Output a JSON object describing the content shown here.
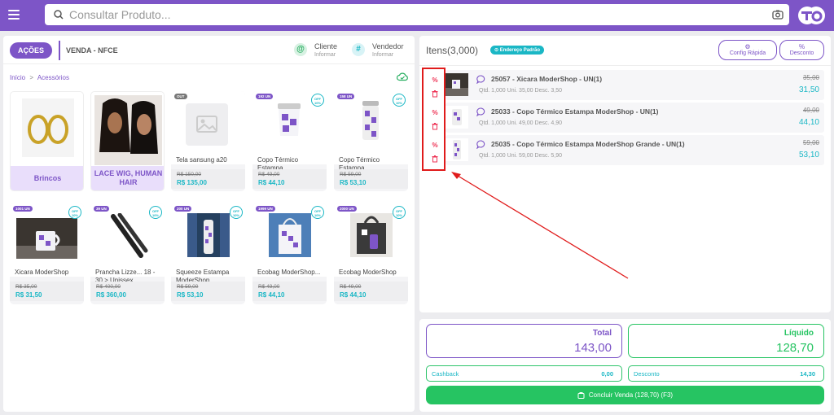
{
  "search": {
    "placeholder": "Consultar Produto..."
  },
  "left": {
    "acoes": "AÇÕES",
    "venda": "VENDA - NFCE",
    "cliente": {
      "label": "Cliente",
      "sub": "Informar",
      "icon": "@"
    },
    "vendedor": {
      "label": "Vendedor",
      "sub": "Informar",
      "icon": "#"
    },
    "breadcrumb": {
      "home": "Início",
      "sep": ">",
      "current": "Acessórios"
    }
  },
  "categories": [
    {
      "label": "Brincos"
    },
    {
      "label": "LACE WIG, HUMAN HAIR"
    }
  ],
  "products": [
    {
      "badge": "OUT",
      "off": "",
      "name": "Tela sansung a20",
      "old": "R$ 150,00",
      "new": "R$ 135,00"
    },
    {
      "badge": "192 UN",
      "off": "OFF 10%",
      "name": "Copo Térmico Estampa...",
      "old": "R$ 49,00",
      "new": "R$ 44,10"
    },
    {
      "badge": "158 UN",
      "off": "OFF 10%",
      "name": "Copo Térmico Estampa...",
      "old": "R$ 59,00",
      "new": "R$ 53,10"
    },
    {
      "badge": "1001 UN",
      "off": "OFF 10%",
      "name": "Xicara ModerShop",
      "old": "R$ 35,00",
      "new": "R$ 31,50"
    },
    {
      "badge": "39 UN",
      "off": "OFF 10%",
      "name": "Prancha Lizze... 18 - 30 > Unissex",
      "old": "R$ 400,00",
      "new": "R$ 360,00"
    },
    {
      "badge": "200 UN",
      "off": "OFF 10%",
      "name": "Squeeze Estampa ModerShop",
      "old": "R$ 59,00",
      "new": "R$ 53,10"
    },
    {
      "badge": "1999 UN",
      "off": "OFF 10%",
      "name": "Ecobag ModerShop...",
      "old": "R$ 49,00",
      "new": "R$ 44,10"
    },
    {
      "badge": "2000 UN",
      "off": "OFF 10%",
      "name": "Ecobag ModerShop",
      "old": "R$ 49,00",
      "new": "R$ 44,10"
    }
  ],
  "right": {
    "title": "Itens(3,000)",
    "address": "⊙ Endereço Padrão",
    "config": {
      "label": "Config Rápida",
      "icon": "⚙"
    },
    "desconto": {
      "label": "Desconto",
      "icon": "%"
    }
  },
  "items": [
    {
      "title": "25057 - Xicara ModerShop - UN(1)",
      "qtd": "Qtd. 1,000",
      "uni": "Uni. 35,00",
      "desc": "Desc. 3,50",
      "old": "35,00",
      "new": "31,50"
    },
    {
      "title": "25033 - Copo Térmico Estampa ModerShop - UN(1)",
      "qtd": "Qtd. 1,000",
      "uni": "Uni. 49,00",
      "desc": "Desc. 4,90",
      "old": "49,00",
      "new": "44,10"
    },
    {
      "title": "25035 - Copo Térmico Estampa ModerShop Grande - UN(1)",
      "qtd": "Qtd. 1,000",
      "uni": "Uni. 59,00",
      "desc": "Desc. 5,90",
      "old": "59,00",
      "new": "53,10"
    }
  ],
  "totals": {
    "total": {
      "label": "Total",
      "value": "143,00"
    },
    "liquido": {
      "label": "Líquido",
      "value": "128,70"
    },
    "cashback": {
      "label": "Cashback",
      "value": "0,00"
    },
    "desconto": {
      "label": "Desconto",
      "value": "14,30"
    },
    "concluir": "Concluir Venda (128,70) (F3)"
  },
  "colors": {
    "brand": "#7d55c7",
    "accent": "#1ab7c5",
    "success": "#26c462",
    "danger": "#e01b1b"
  }
}
